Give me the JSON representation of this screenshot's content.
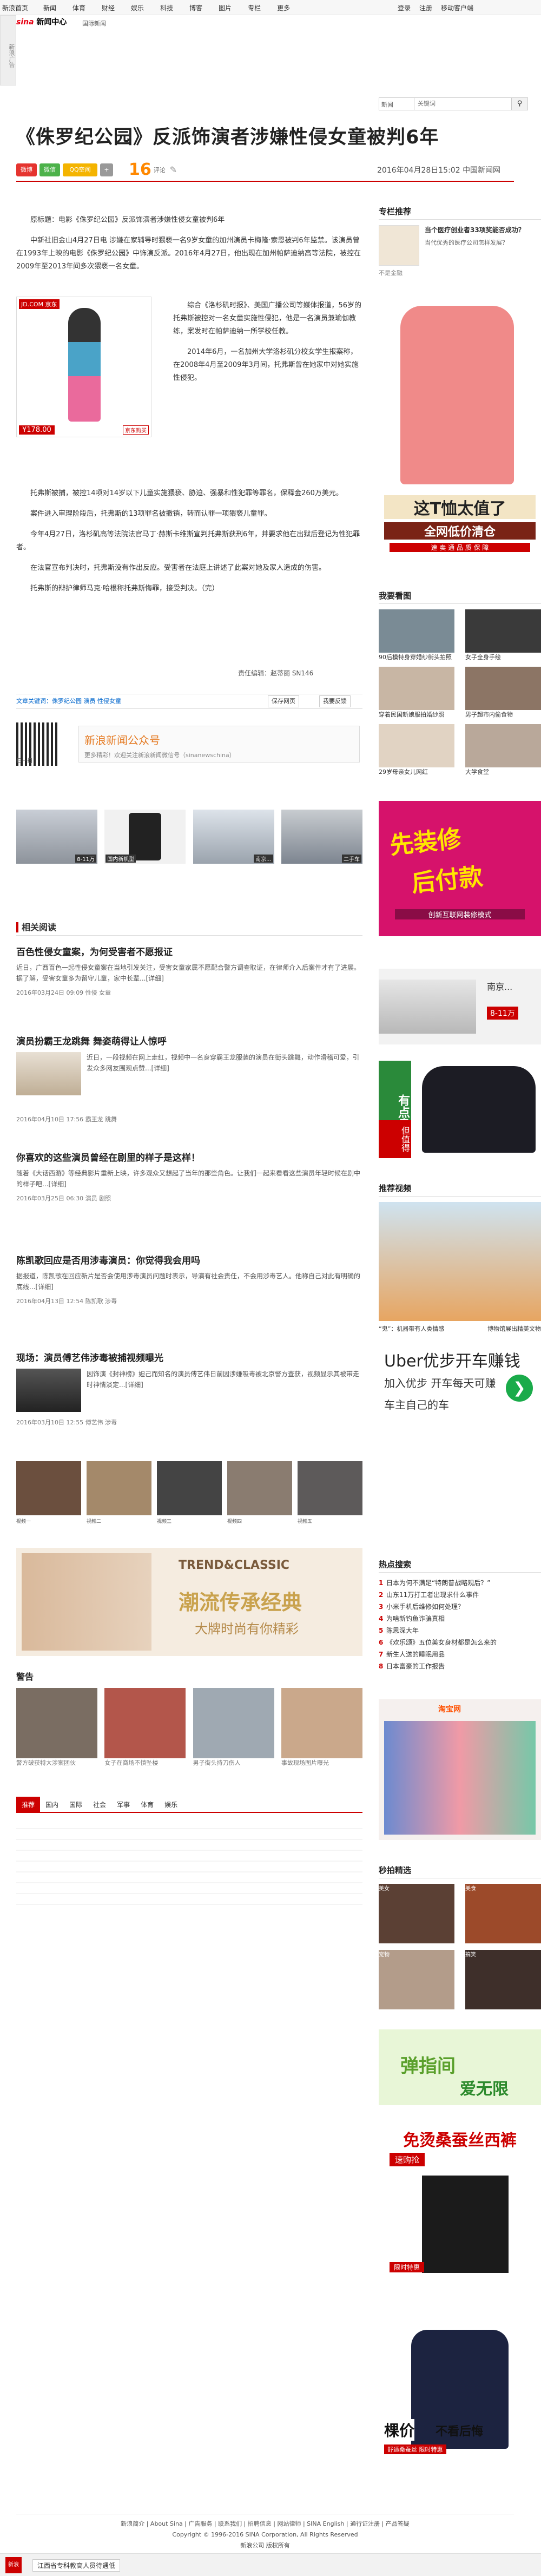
{
  "topbar": {
    "brand": "新浪首页",
    "items": [
      "新闻",
      "体育",
      "财经",
      "娱乐",
      "科技",
      "博客",
      "图片",
      "专栏",
      "更多"
    ],
    "login": "登录",
    "register": "注册",
    "mobile": "移动客户端"
  },
  "ad_side": "新浪广告",
  "header": {
    "logo": "新闻中心",
    "logo_brand": "sina",
    "crumb": "国际新闻",
    "search_select": "新闻",
    "search_placeholder": "关键词"
  },
  "title": "《侏罗纪公园》反派饰演者涉嫌性侵女童被判6年",
  "share": {
    "weibo": "微博",
    "weixin": "微信",
    "qzone": "QQ空间",
    "plus": "+"
  },
  "comments": {
    "count": "16",
    "label": "评论"
  },
  "meta": {
    "date": "2016年04月28日15:02",
    "source": "中国新闻网"
  },
  "article": {
    "p1": "原标题：电影《侏罗纪公园》反派饰演者涉嫌性侵女童被判6年",
    "p2": "中新社旧金山4月27日电 涉嫌在家辅导时猥亵一名9岁女童的加州演员卡梅隆·索恩被判6年监禁。该演员曾在1993年上映的电影《侏罗纪公园》中饰演反派。2016年4月27日，他出现在加州帕萨迪纳高等法院，被控在2009年至2013年间多次猥亵一名女童。",
    "p3": "综合《洛杉矶时报》、美国广播公司等媒体报道，56岁的托弗斯被控对一名女童实施性侵犯，他是一名演员兼瑜伽教练，案发时在帕萨迪纳一所学校任教。",
    "p4": "2014年6月，一名加州大学洛杉矶分校女学生报案称，在2008年4月至2009年3月间，托弗斯曾在她家中对她实施性侵犯。",
    "p5": "托弗斯被捕，被控14项对14岁以下儿童实施猥亵、胁迫、强暴和性犯罪等罪名，保释金260万美元。",
    "p6": "案件进入审理阶段后，托弗斯的13项罪名被撤销，转而认罪一项猥亵儿童罪。",
    "p7": "今年4月27日，洛杉矶高等法院法官马丁·赫斯卡维斯宣判托弗斯获刑6年，并要求他在出狱后登记为性犯罪者。",
    "p8": "在法官宣布判决时，托弗斯没有作出反应。受害者在法庭上讲述了此案对她及家人造成的伤害。",
    "p9": "托弗斯的辩护律师马克·哈根称托弗斯悔罪，接受判决。（完）",
    "editor": "责任编辑：赵蒂丽 SN146",
    "links": "文章关键词：侏罗纪公园 演员 性侵女童",
    "save": "保存网页",
    "report": "我要反馈"
  },
  "product": {
    "badge": "JD.COM 京东",
    "price": "¥178.00",
    "buy": "京东购买"
  },
  "weixin_box": {
    "title": "新浪新闻公众号",
    "desc": "更多精彩！欢迎关注新浪新闻微信号（sinanewschina）",
    "scan": "扫一扫"
  },
  "ads_row": [
    {
      "label": "8-11万"
    },
    {
      "label": "国内新机型"
    },
    {
      "label": "南京..."
    },
    {
      "label": "二手车"
    }
  ],
  "related": {
    "title": "相关阅读",
    "items": [
      {
        "title": "百色性侵女童案，为何受害者不愿报证",
        "summary": "近日，广西百色一起性侵女童案在当地引发关注，受害女童家属不愿配合警方调查取证，在律师介入后案件才有了进展。据了解，受害女童多为留守儿童，家中长辈...[详细]",
        "date": "2016年03月24日 09:09",
        "tags": "性侵 女童"
      },
      {
        "title": "演员扮霸王龙跳舞 舞姿萌得让人惊呼",
        "summary": "近日，一段视频在网上走红，视频中一名身穿霸王龙服装的演员在街头跳舞，动作滑稽可爱，引发众多网友围观点赞...[详细]",
        "date": "2016年04月10日 17:56",
        "tags": "霸王龙 跳舞"
      },
      {
        "title": "你喜欢的这些演员曾经在剧里的样子是这样！",
        "summary": "随着《大话西游》等经典影片重新上映，许多观众又想起了当年的那些角色。让我们一起来看看这些演员年轻时候在剧中的样子吧...[详细]",
        "date": "2016年03月25日 06:30",
        "tags": "演员 剧照"
      },
      {
        "title": "陈凯歌回应是否用涉毒演员：你觉得我会用吗",
        "summary": "据报道，陈凯歌在回应新片是否会使用涉毒演员问题时表示，导演有社会责任，不会用涉毒艺人。他称自己对此有明确的底线...[详细]",
        "date": "2016年04月13日 12:54",
        "tags": "陈凯歌 涉毒"
      },
      {
        "title": "现场：演员傅艺伟涉毒被捕视频曝光",
        "summary": "因饰演《封神榜》妲己而知名的演员傅艺伟日前因涉嫌吸毒被北京警方查获，视频显示其被带走时神情淡定...[详细]",
        "date": "2016年03月10日 12:55",
        "tags": "傅艺伟 涉毒"
      }
    ]
  },
  "video_row": [
    "视频一",
    "视频二",
    "视频三",
    "视频四",
    "视频五"
  ],
  "trend_ad": {
    "main": "潮流传承经典",
    "sub": "大牌时尚有你精彩",
    "tag": "TREND&CLASSIC"
  },
  "police": {
    "title": "警告",
    "items": [
      "警方破获特大涉案团伙",
      "女子在商场不慎坠楼",
      "男子街头持刀伤人",
      "事故现场图片曝光"
    ]
  },
  "bottom_tabs": [
    "推荐",
    "国内",
    "国际",
    "社会",
    "军事",
    "体育",
    "娱乐"
  ],
  "sidebar": {
    "zhuanlan": {
      "title": "专栏推荐",
      "item_title": "当个医疗创业者33项奖能否成功？",
      "item_desc": "当代优秀的医疗公司怎样发展？",
      "author": "不是金融",
      "tags": [
        "医疗",
        "创业"
      ]
    },
    "tshirt_ad": {
      "line1": "这T恤太值了",
      "line2": "全网低价清仓",
      "line3": "速 卖 通 品 质 保 障"
    },
    "picks": {
      "title": "我要看图",
      "items": [
        "90后模特身穿婚纱街头拍照",
        "女子全身手绘",
        "穿着民国新娘服拍婚纱照",
        "男子超市内偷食物",
        "29岁母亲女儿网红",
        "大学食堂"
      ]
    },
    "sale_ad": {
      "line1": "先装修",
      "line2": "后付款",
      "line3": "创新互联网装修模式"
    },
    "car_ad": {
      "label": "南京...",
      "price": "8-11万"
    },
    "clothes_ad": {
      "line1": "有点贵",
      "line2": "但值得"
    },
    "recommend": {
      "title": "推荐视频",
      "items": [
        "“鬼”：机器带有人类情感",
        "博物馆展出精美文物"
      ]
    },
    "uber_ad": {
      "line1": "Uber优步开车赚钱",
      "line2": "加入优步 开车每天可赚",
      "line3": "车主自己的车"
    },
    "hot": {
      "title": "热点搜索",
      "items": [
        "日本为何不满足“特朗普战略观后？”",
        "山东11万打工者出现求什么事件",
        "小米手机后维修如何处理？",
        "为啥新钓鱼诈骗真相",
        "陈思深大年",
        "《欢乐颂》五位美女身材都是怎么来的",
        "新生人送的睡眠用品",
        "日本富豪的工作报告"
      ]
    },
    "store_ad": "淘宝网",
    "miaosha": {
      "title": "秒拍精选",
      "items": [
        "美女",
        "美食",
        "宠物",
        "搞笑"
      ]
    },
    "bounce_ad": {
      "line1": "弹指间",
      "line2": "爱无限"
    },
    "pants_ad": {
      "line1": "免烫桑蚕丝西裤",
      "line2": "速购抢",
      "line3": "限时特惠"
    },
    "shirt_ad": {
      "line1": "棵价",
      "line2": "不看后悔",
      "line3": "舒适桑蚕丝 限时特惠"
    }
  },
  "footer": {
    "links": "新浪简介 | About Sina | 广告服务 | 联系我们 | 招聘信息 | 网站律师 | SINA English | 通行证注册 | 产品答疑",
    "copyright": "Copyright © 1996-2016 SINA Corporation, All Rights Reserved",
    "company": "新浪公司 版权所有"
  },
  "bottom_bar": {
    "text": "江西省专科教高人员待遇低",
    "icon": "新浪"
  }
}
